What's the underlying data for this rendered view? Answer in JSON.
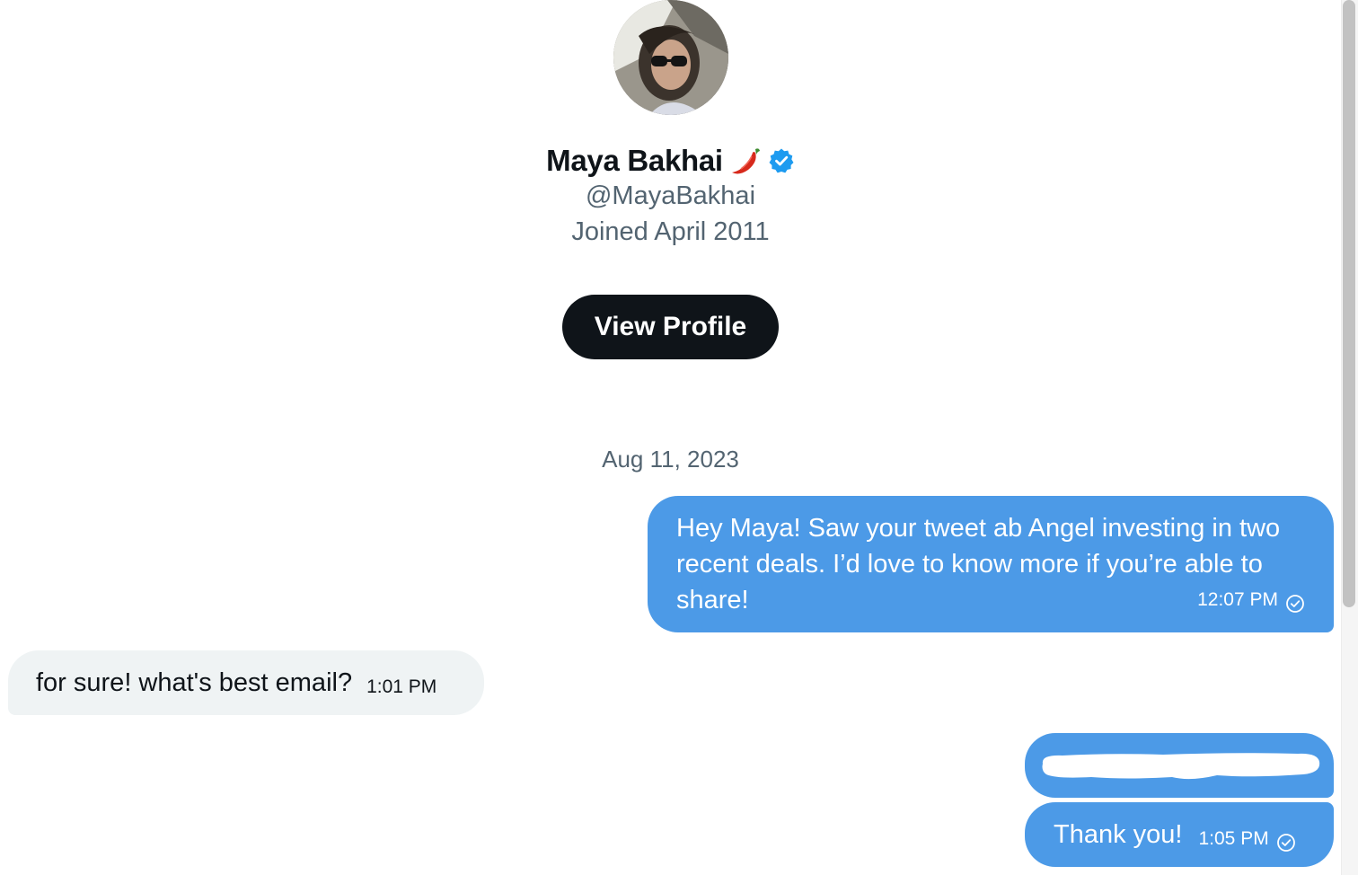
{
  "profile": {
    "name": "Maya Bakhai",
    "handle": "@MayaBakhai",
    "joined": "Joined April 2011",
    "view_profile_label": "View Profile"
  },
  "conversation": {
    "date_separator": "Aug 11, 2023",
    "messages": [
      {
        "direction": "outgoing",
        "text": "Hey Maya! Saw your tweet ab Angel investing in two recent deals. I’d love to know more if you’re able to share!",
        "time": "12:07 PM",
        "status_icon": "sent-check-icon"
      },
      {
        "direction": "incoming",
        "text": "for sure! what's best email?",
        "time": "1:01 PM"
      },
      {
        "direction": "outgoing",
        "text": "",
        "redacted": true
      },
      {
        "direction": "outgoing",
        "text": "Thank you!",
        "time": "1:05 PM",
        "status_icon": "sent-check-icon"
      }
    ]
  },
  "colors": {
    "outgoing_bubble": "#4c9ae7",
    "incoming_bubble": "#eff3f4",
    "primary_text": "#0f1419",
    "secondary_text": "#536471",
    "button_bg": "#0f1419",
    "verified_badge": "#1d9bf0"
  },
  "icons": {
    "name_emoji": "chili-pepper-icon",
    "verified": "verified-badge-icon"
  }
}
